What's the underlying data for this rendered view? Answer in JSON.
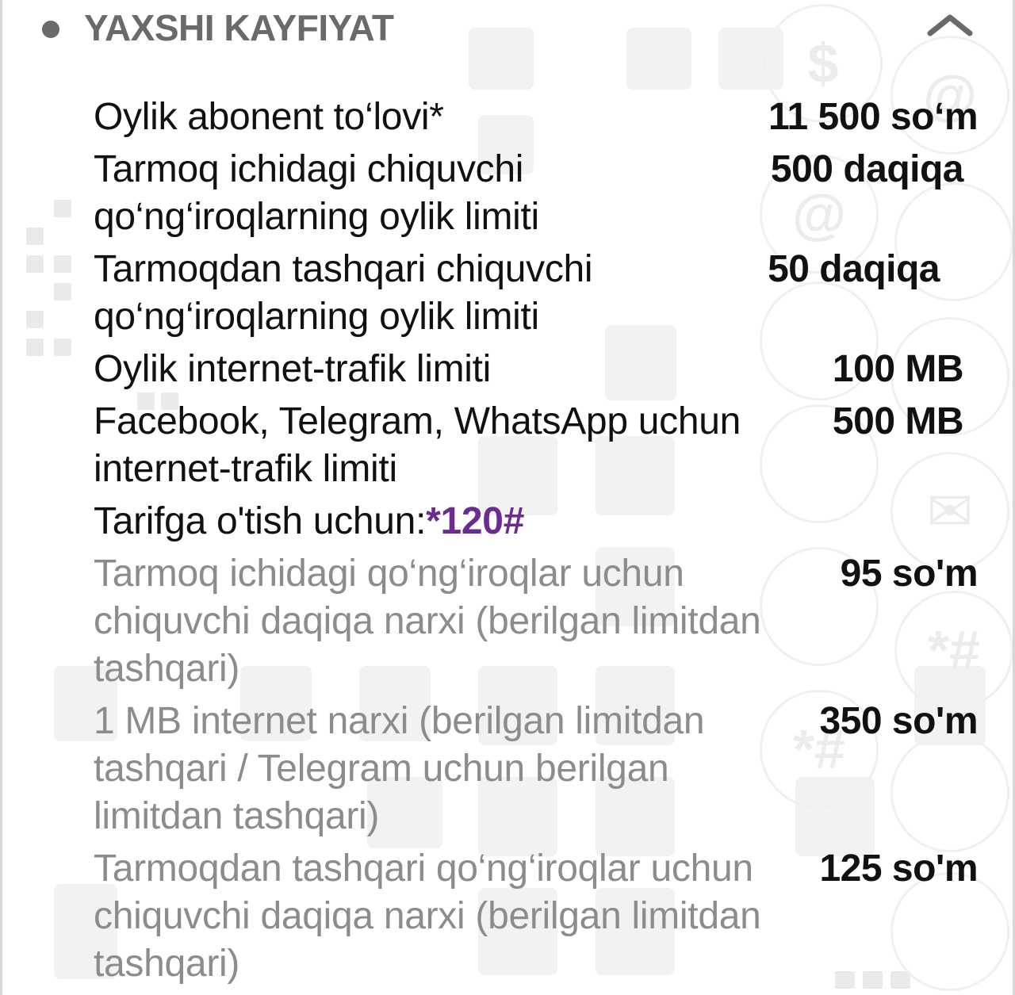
{
  "header": {
    "title": "YAXSHI KAYFIYAT",
    "collapse_icon": "chevron-up-icon"
  },
  "rows": [
    {
      "label": "Oylik abonent to‘lovi*",
      "value": "11 500 so‘m"
    },
    {
      "label": "Tarmoq ichidagi chiquvchi qo‘ng‘iroqlarning oylik limiti",
      "value": "500 daqiqa"
    },
    {
      "label": "Tarmoqdan tashqari chiquvchi qo‘ng‘iroqlarning oylik limiti",
      "value": "50 daqiqa"
    },
    {
      "label": "Oylik internet-trafik limiti",
      "value": "100 MB"
    },
    {
      "label": "Facebook, Telegram, WhatsApp uchun internet-trafik limiti",
      "value": "500 MB"
    }
  ],
  "switch_tariff": {
    "label": "Tarifga o'tish uchun:",
    "code": "*120#"
  },
  "extra_rows": [
    {
      "label": "Tarmoq ichidagi qo‘ng‘iroqlar uchun chiquvchi daqiqa narxi (berilgan limitdan tashqari)",
      "value": "95 so'm"
    },
    {
      "label": "1 MB internet narxi (berilgan limitdan tashqari / Telegram uchun berilgan limitdan tashqari)",
      "value": "350 so'm"
    },
    {
      "label": "Tarmoqdan tashqari qo‘ng‘iroqlar uchun chiquvchi daqiqa narxi (berilgan limitdan tashqari)",
      "value": "125 so'm"
    }
  ],
  "colors": {
    "code_accent": "#6a2c91",
    "title_gray": "#6a6a6a",
    "dim_text": "#8c8c8c"
  }
}
